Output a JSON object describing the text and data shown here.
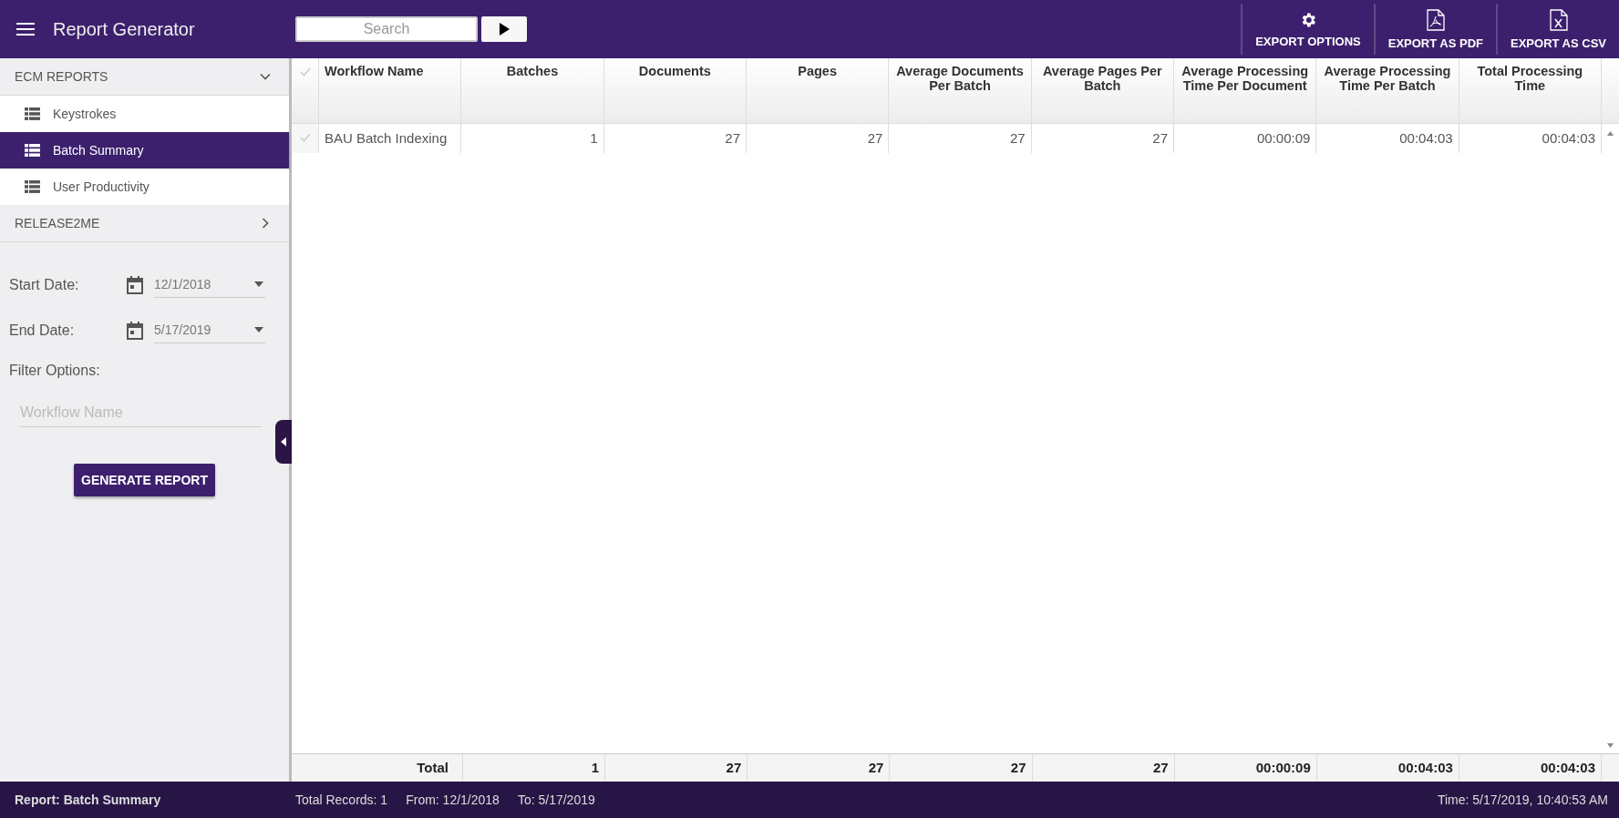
{
  "app_bar": {
    "title": "Report Generator",
    "search": {
      "placeholder": "Search"
    },
    "actions": [
      {
        "label": "EXPORT OPTIONS",
        "kind": "gear"
      },
      {
        "label": "EXPORT AS PDF",
        "kind": "pdf"
      },
      {
        "label": "EXPORT AS CSV",
        "kind": "csv"
      }
    ]
  },
  "sidebar": {
    "groups": [
      {
        "label": "ECM REPORTS",
        "expanded": true,
        "items": [
          {
            "label": "Keystrokes",
            "selected": false
          },
          {
            "label": "Batch Summary",
            "selected": true
          },
          {
            "label": "User Productivity",
            "selected": false
          }
        ]
      },
      {
        "label": "RELEASE2ME",
        "expanded": false
      }
    ],
    "dates": [
      {
        "label": "Start Date:",
        "value": "12/1/2018"
      },
      {
        "label": "End Date:",
        "value": "5/17/2019"
      }
    ],
    "filter_label": "Filter Options:",
    "filter": {
      "placeholder": "Workflow Name"
    },
    "button": "GENERATE REPORT"
  },
  "table": {
    "columns": [
      {
        "label": "Workflow Name"
      },
      {
        "label": "Batches"
      },
      {
        "label": "Documents"
      },
      {
        "label": "Pages"
      },
      {
        "label": "Average Documents Per Batch"
      },
      {
        "label": "Average Pages Per Batch"
      },
      {
        "label": "Average Processing Time Per Document"
      },
      {
        "label": "Average Processing Time Per Batch"
      },
      {
        "label": "Total Processing Time"
      }
    ],
    "rows": [
      {
        "checked": false,
        "cells": [
          "BAU Batch Indexing",
          "1",
          "27",
          "27",
          "27",
          "27",
          "00:00:09",
          "00:04:03",
          "00:04:03"
        ]
      }
    ],
    "totals": [
      "Total",
      "1",
      "27",
      "27",
      "27",
      "27",
      "00:00:09",
      "00:04:03",
      "00:04:03"
    ]
  },
  "status_bar": {
    "report": "Report: Batch Summary",
    "records": "Total Records: 1",
    "from": "From: 12/1/2018",
    "to": "To: 5/17/2019",
    "time": "Time: 5/17/2019, 10:40:53 AM"
  }
}
